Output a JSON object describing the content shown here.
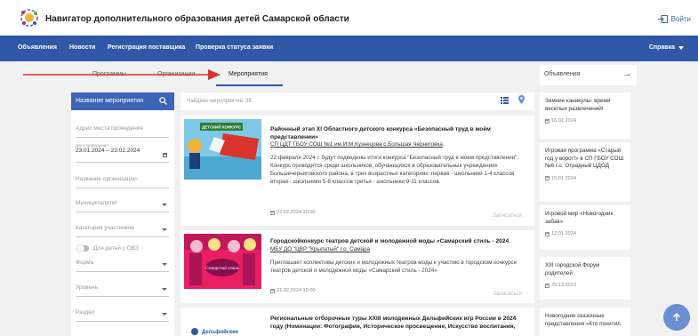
{
  "header": {
    "title": "Навигатор дополнительного образования детей Самарской области",
    "login_label": "Войти"
  },
  "nav": {
    "items": [
      "Объявления",
      "Новости",
      "Регистрация поставщика",
      "Проверка статуса заявки"
    ],
    "help_label": "Справка"
  },
  "tabs": [
    "Программы",
    "Организации",
    "Мероприятия"
  ],
  "filters": {
    "search_button": "Название мероприятия",
    "address_placeholder": "Адрес места проведения",
    "period_label": "Дата проведения",
    "period_value": "23.01.2024 – 23.02.2024",
    "organization_placeholder": "Название организации",
    "municipality_placeholder": "Муниципалитет",
    "category_placeholder": "Категория участников",
    "ovz_label": "Для детей с ОВЗ",
    "form_placeholder": "Форма",
    "level_placeholder": "Уровень",
    "section_placeholder": "Раздел"
  },
  "results": {
    "found_label": "Найдено мероприятий: 35"
  },
  "events": [
    {
      "title": "Районный этап XI Областного детского конкурса «Безопасный труд в моём представлении»",
      "org": "СП ЦДТ ГБОУ СОШ №1 им.И.М.Кузнецова с.Большая Черниговка",
      "desc": "22 февраля 2024 г. будут подведены итоги конкурса \"Безопасный труд в моем представлении\". Конкурс проводится среди школьников, обучающихся в образовательных учреждениях Большечерниговского района, в трех возрастных категориях: первая - школьники 1-4 классов вторая - школьники 5-8 классов третья - школьники 9-11 классов.",
      "date": "22.02.2024 10:00",
      "signup": "Записаться",
      "image_caption": "ДЕТСКИЙ КОНКУРС"
    },
    {
      "title": "Городскойконкурс театров детской и молодежной моды «Самарский стиль - 2024",
      "org": "МБУ ДО \"ЦВР \"Крылатый\" г.о. Самара",
      "desc": "Приглашает коллективы детских и молодежных театров моды к участию в городском конкурсе театров детской и молодежной моды «Самарский стиль - 2024»",
      "date": "21.02.2024 10:00",
      "signup": "Записаться",
      "image_caption": "Самарский стиль"
    },
    {
      "title": "Региональные отборочные туры XXIII молодежных Дельфийских игр России в 2024 году (Номинации: Фотография, Историческое просвещение, Искусство воспитания,",
      "image_caption": "Дельфийские"
    }
  ],
  "announcements": {
    "title": "Объявления",
    "items": [
      {
        "text": "Зимние каникулы- время весёлых развлечений!",
        "date": "16.01.2024"
      },
      {
        "text": "Игровая программа «Старый год у ворот!» в СП ГБОУ СОШ №6 г.о. Отрадный ЦДОД",
        "date": "15.01.2024"
      },
      {
        "text": "Игровой мир «Новогодних забав»",
        "date": "12.01.2024"
      },
      {
        "text": "XIII городской Форум родителей",
        "date": "25.12.2023"
      },
      {
        "text": "Новогодние сказочные представления «Кто похитил"
      }
    ]
  },
  "colors": {
    "navbar": "#2f58a8",
    "accent": "#3e64b8",
    "arrow": "#d9342b"
  }
}
